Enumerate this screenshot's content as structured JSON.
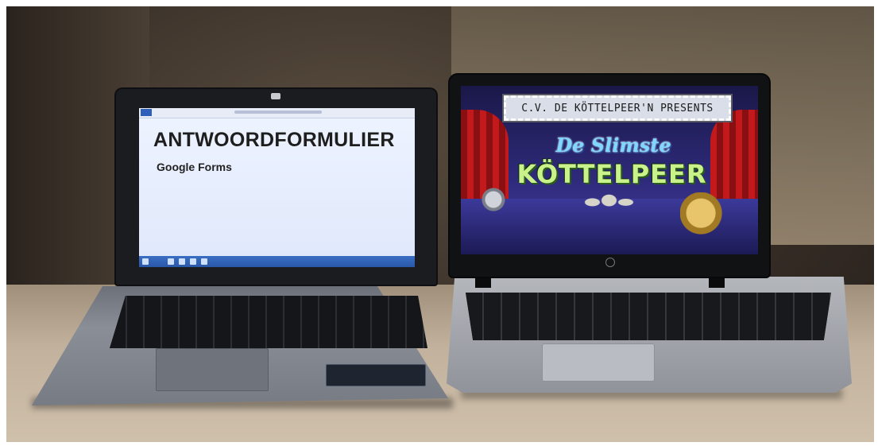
{
  "left_laptop": {
    "slide_title": "ANTWOORDFORMULIER",
    "slide_subtitle": "Google Forms"
  },
  "right_laptop": {
    "banner": "C.V. DE KÖTTELPEER'N PRESENTS",
    "show_line1": "De Slimste",
    "show_line2": "KÖTTELPEER"
  }
}
